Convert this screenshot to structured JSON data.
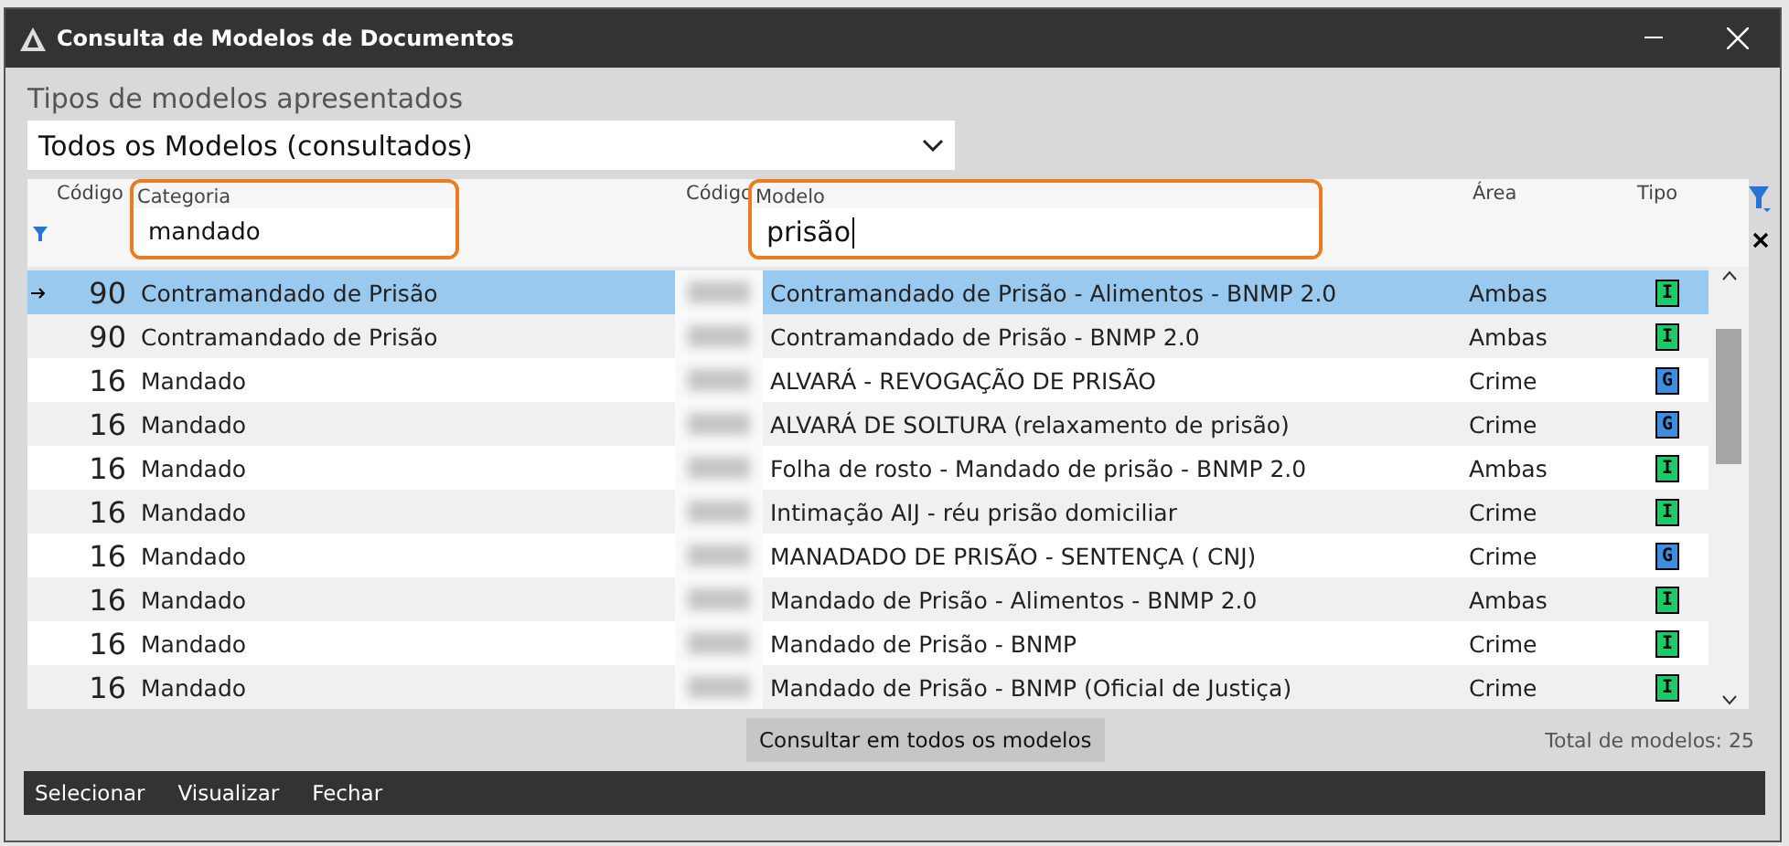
{
  "window": {
    "title": "Consulta de Modelos de Documentos"
  },
  "types_label": "Tipos de modelos apresentados",
  "types_select": {
    "value": "Todos os Modelos (consultados)"
  },
  "columns": [
    {
      "label": "Código"
    },
    {
      "label": "Categoria",
      "filter": "mandado",
      "highlighted": true,
      "focused": false
    },
    {
      "label": "Código"
    },
    {
      "label": "Modelo",
      "filter": "prisão",
      "highlighted": true,
      "focused": true
    },
    {
      "label": "Área"
    },
    {
      "label": "Tipo"
    }
  ],
  "rows": [
    {
      "selected": true,
      "cat_code": "90",
      "category": "Contramandado de Prisão",
      "model": "Contramandado de Prisão - Alimentos - BNMP 2.0",
      "area": "Ambas",
      "type": {
        "letter": "I",
        "color": "#1ec96a"
      }
    },
    {
      "selected": false,
      "cat_code": "90",
      "category": "Contramandado de Prisão",
      "model": "Contramandado de Prisão - BNMP 2.0",
      "area": "Ambas",
      "type": {
        "letter": "I",
        "color": "#1ec96a"
      }
    },
    {
      "selected": false,
      "cat_code": "16",
      "category": "Mandado",
      "model": "ALVARÁ - REVOGAÇÃO DE PRISÃO",
      "area": "Crime",
      "type": {
        "letter": "G",
        "color": "#3c8ee0"
      }
    },
    {
      "selected": false,
      "cat_code": "16",
      "category": "Mandado",
      "model": "ALVARÁ DE SOLTURA (relaxamento de prisão)",
      "area": "Crime",
      "type": {
        "letter": "G",
        "color": "#3c8ee0"
      }
    },
    {
      "selected": false,
      "cat_code": "16",
      "category": "Mandado",
      "model": "Folha de rosto - Mandado de prisão - BNMP 2.0",
      "area": "Ambas",
      "type": {
        "letter": "I",
        "color": "#1ec96a"
      }
    },
    {
      "selected": false,
      "cat_code": "16",
      "category": "Mandado",
      "model": "Intimação AIJ - réu prisão domiciliar",
      "area": "Crime",
      "type": {
        "letter": "I",
        "color": "#1ec96a"
      }
    },
    {
      "selected": false,
      "cat_code": "16",
      "category": "Mandado",
      "model": "MANADADO DE PRISÃO - SENTENÇA ( CNJ)",
      "area": "Crime",
      "type": {
        "letter": "G",
        "color": "#3c8ee0"
      }
    },
    {
      "selected": false,
      "cat_code": "16",
      "category": "Mandado",
      "model": "Mandado de Prisão - Alimentos - BNMP 2.0",
      "area": "Ambas",
      "type": {
        "letter": "I",
        "color": "#1ec96a"
      }
    },
    {
      "selected": false,
      "cat_code": "16",
      "category": "Mandado",
      "model": "Mandado de Prisão - BNMP",
      "area": "Crime",
      "type": {
        "letter": "I",
        "color": "#1ec96a"
      }
    },
    {
      "selected": false,
      "cat_code": "16",
      "category": "Mandado",
      "model": "Mandado de Prisão - BNMP (Oficial de Justiça)",
      "area": "Crime",
      "type": {
        "letter": "I",
        "color": "#1ec96a"
      }
    }
  ],
  "search_all_button": "Consultar em todos os modelos",
  "total": "Total de modelos: 25",
  "footer_actions": [
    "Selecionar",
    "Visualizar",
    "Fechar"
  ]
}
